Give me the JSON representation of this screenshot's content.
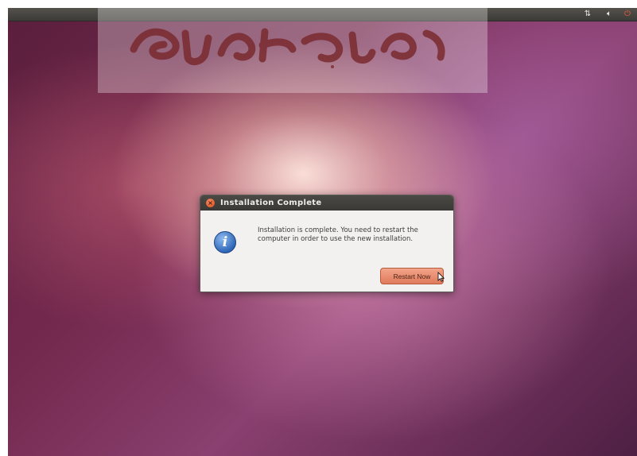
{
  "dialog": {
    "title": "Installation Complete",
    "message": "Installation is complete. You need to restart the computer in order to use the new installation.",
    "button_label": "Restart Now",
    "icon": "info-icon",
    "close_icon": "close-icon"
  },
  "top_panel": {
    "icons": [
      "network-icon",
      "volume-icon",
      "power-icon"
    ]
  },
  "colors": {
    "panel": "#3c3b37",
    "dialog_background": "#f2f1f0",
    "titlebar": "#3a3935",
    "close_button": "#df4b16",
    "button_accent": "#e07a5c",
    "info_icon": "#2f67b8"
  }
}
